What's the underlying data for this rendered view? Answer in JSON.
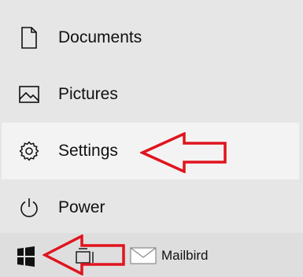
{
  "start_menu": {
    "items": [
      {
        "label": "Documents",
        "icon": "document-icon"
      },
      {
        "label": "Pictures",
        "icon": "pictures-icon"
      },
      {
        "label": "Settings",
        "icon": "gear-icon",
        "highlighted": true
      },
      {
        "label": "Power",
        "icon": "power-icon"
      }
    ]
  },
  "taskbar": {
    "start_icon": "windows-logo-icon",
    "task_view_icon": "task-view-icon",
    "apps": [
      {
        "label": "Mailbird",
        "icon": "mail-icon"
      }
    ]
  },
  "annotations": {
    "arrow_color": "#e0141e"
  }
}
